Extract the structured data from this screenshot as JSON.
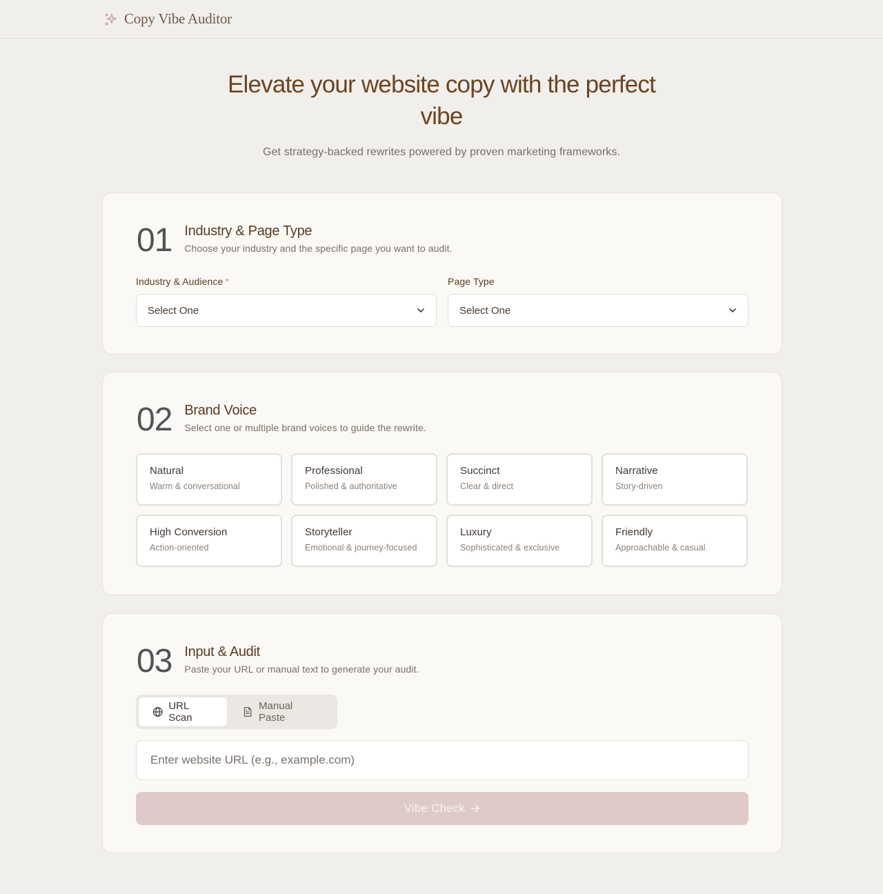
{
  "app": {
    "name": "Copy Vibe Auditor",
    "icon": "sparkles-icon",
    "accent_color": "#c9a0a4"
  },
  "hero": {
    "title": "Elevate your website copy with the perfect vibe",
    "subtitle": "Get strategy-backed rewrites powered by proven marketing frameworks."
  },
  "step1": {
    "number": "01",
    "title": "Industry & Page Type",
    "description": "Choose your industry and the specific page you want to audit.",
    "industry_label": "Industry & Audience",
    "required_mark": "*",
    "industry_value": "Select One",
    "page_type_label": "Page Type",
    "page_type_value": "Select One"
  },
  "step2": {
    "number": "02",
    "title": "Brand Voice",
    "description": "Select one or multiple brand voices to guide the rewrite.",
    "voices": [
      {
        "name": "Natural",
        "desc": "Warm & conversational"
      },
      {
        "name": "Professional",
        "desc": "Polished & authoritative"
      },
      {
        "name": "Succinct",
        "desc": "Clear & direct"
      },
      {
        "name": "Narrative",
        "desc": "Story-driven"
      },
      {
        "name": "High Conversion",
        "desc": "Action-oriented"
      },
      {
        "name": "Storyteller",
        "desc": "Emotional & journey-focused"
      },
      {
        "name": "Luxury",
        "desc": "Sophisticated & exclusive"
      },
      {
        "name": "Friendly",
        "desc": "Approachable & casual"
      }
    ]
  },
  "step3": {
    "number": "03",
    "title": "Input & Audit",
    "description": "Paste your URL or manual text to generate your audit.",
    "tabs": [
      {
        "label": "URL Scan",
        "icon": "globe-icon",
        "active": true
      },
      {
        "label": "Manual Paste",
        "icon": "document-icon",
        "active": false
      }
    ],
    "url_placeholder": "Enter website URL (e.g., example.com)",
    "url_value": "",
    "cta_label": "Vibe Check",
    "cta_icon": "arrow-right-icon",
    "cta_color": "#decbc9"
  }
}
